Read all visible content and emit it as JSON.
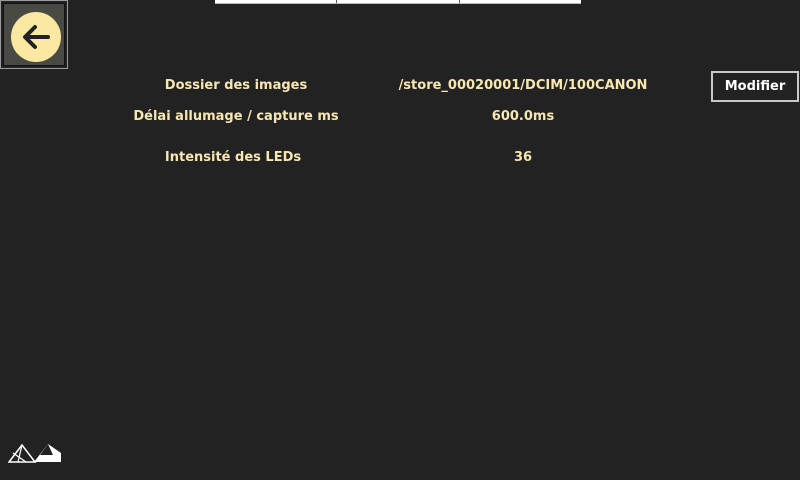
{
  "nav": {
    "back_icon": "arrow-left-icon",
    "tab_count": 3
  },
  "settings": {
    "rows": [
      {
        "label": "Dossier des images",
        "value": "/store_00020001/DCIM/100CANON"
      },
      {
        "label": "Délai allumage / capture ms",
        "value": "600.0ms"
      },
      {
        "label": "Intensité des LEDs",
        "value": "36"
      }
    ],
    "modify_label": "Modifier"
  },
  "branding": {
    "logo_icon": "mountains-logo-icon"
  },
  "colors": {
    "background": "#222222",
    "text": "#f7e7b0",
    "accent": "#fbe9a2"
  }
}
